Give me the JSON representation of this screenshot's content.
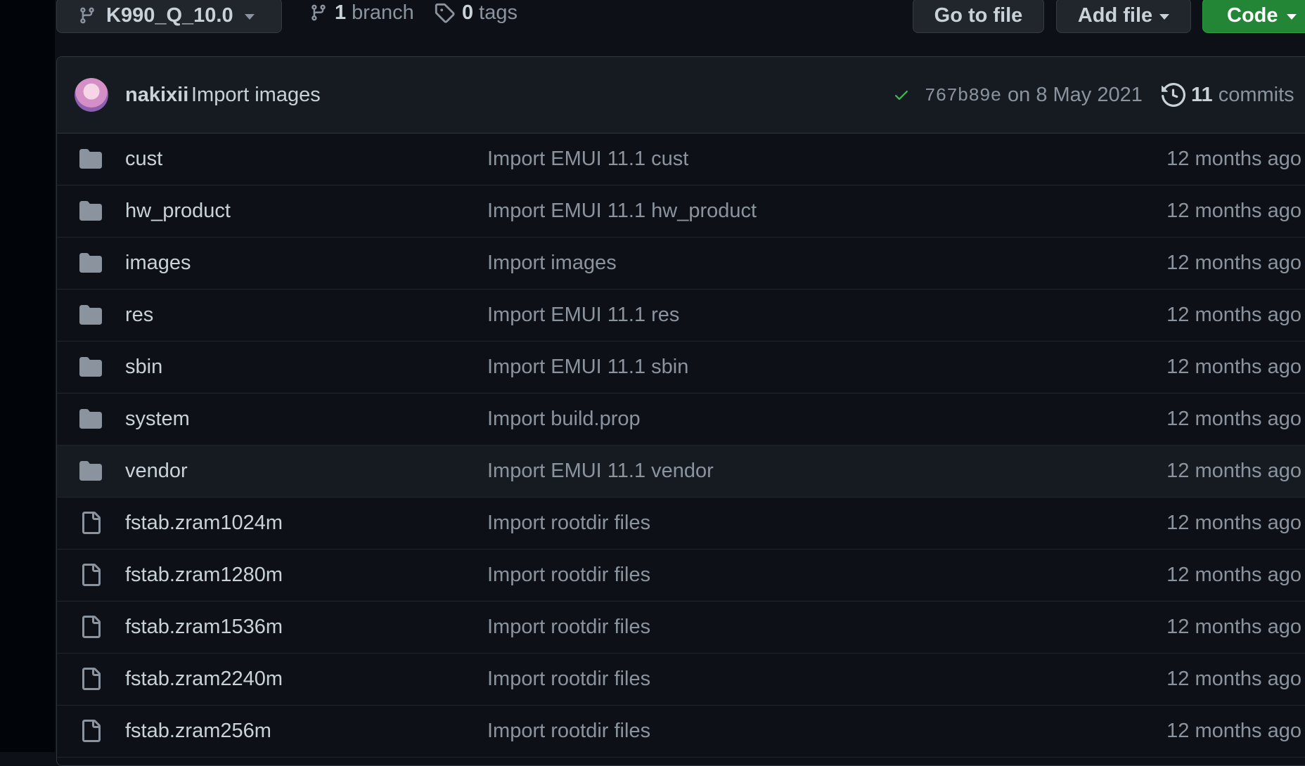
{
  "toolbar": {
    "branch_name": "K990_Q_10.0",
    "branch_count": "1",
    "branch_label": "branch",
    "tag_count": "0",
    "tag_label": "tags",
    "go_to_file": "Go to file",
    "add_file": "Add file",
    "code": "Code"
  },
  "latest_commit": {
    "author": "nakixii",
    "message": "Import images",
    "sha": "767b89e",
    "date": "on 8 May 2021",
    "commit_count": "11",
    "commit_label": "commits"
  },
  "files": [
    {
      "type": "folder",
      "name": "cust",
      "message": "Import EMUI 11.1 cust",
      "age": "12 months ago"
    },
    {
      "type": "folder",
      "name": "hw_product",
      "message": "Import EMUI 11.1 hw_product",
      "age": "12 months ago"
    },
    {
      "type": "folder",
      "name": "images",
      "message": "Import images",
      "age": "12 months ago"
    },
    {
      "type": "folder",
      "name": "res",
      "message": "Import EMUI 11.1 res",
      "age": "12 months ago"
    },
    {
      "type": "folder",
      "name": "sbin",
      "message": "Import EMUI 11.1 sbin",
      "age": "12 months ago"
    },
    {
      "type": "folder",
      "name": "system",
      "message": "Import build.prop",
      "age": "12 months ago"
    },
    {
      "type": "folder",
      "name": "vendor",
      "message": "Import EMUI 11.1 vendor",
      "age": "12 months ago",
      "highlighted": true
    },
    {
      "type": "file",
      "name": "fstab.zram1024m",
      "message": "Import rootdir files",
      "age": "12 months ago"
    },
    {
      "type": "file",
      "name": "fstab.zram1280m",
      "message": "Import rootdir files",
      "age": "12 months ago"
    },
    {
      "type": "file",
      "name": "fstab.zram1536m",
      "message": "Import rootdir files",
      "age": "12 months ago"
    },
    {
      "type": "file",
      "name": "fstab.zram2240m",
      "message": "Import rootdir files",
      "age": "12 months ago"
    },
    {
      "type": "file",
      "name": "fstab.zram256m",
      "message": "Import rootdir files",
      "age": "12 months ago"
    }
  ],
  "colors": {
    "background": "#0d1117",
    "header_bg": "#161b22",
    "border": "#30363d",
    "text": "#c9d1d9",
    "muted": "#8b949e",
    "success": "#3fb950",
    "code_button": "#238636",
    "folder_icon": "#8b949e"
  }
}
